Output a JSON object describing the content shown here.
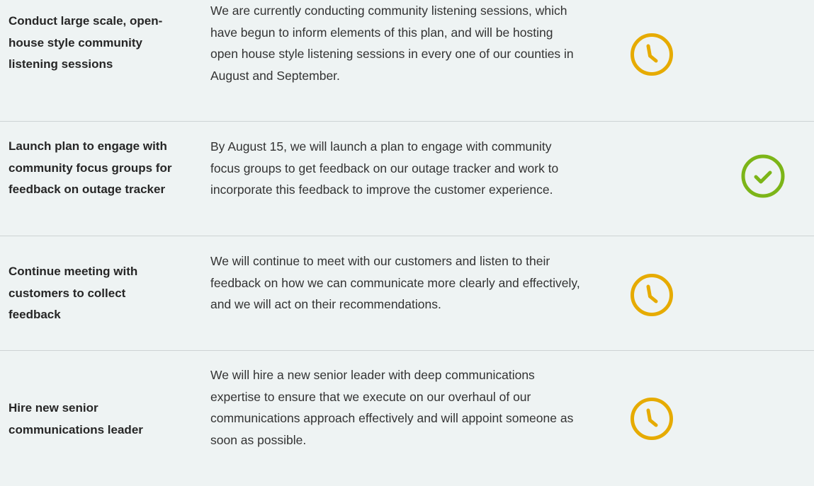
{
  "colors": {
    "background": "#eef3f3",
    "divider": "#cdd3d4",
    "in_progress": "#e6ab00",
    "complete": "#7cb518"
  },
  "rows": [
    {
      "title": "Conduct large scale, open-house style community listening sessions",
      "description": "We are currently conducting community listening sessions, which have begun to inform elements of this plan, and will be hosting open house style listening sessions in every one of our counties in August and September.",
      "status": "in-progress",
      "icon": "clock-icon"
    },
    {
      "title": "Launch plan to engage with community focus groups for feedback on outage tracker",
      "description": "By August 15, we will launch a plan to engage with community focus groups to get feedback on our outage tracker and work to incorporate this feedback to improve the customer experience.",
      "status": "complete",
      "icon": "checkmark-circle-icon"
    },
    {
      "title": "Continue meeting with customers to collect feedback",
      "description": "We will continue to meet with our customers and listen to their feedback on how we can communicate more clearly and effectively, and we will act on their recommendations.",
      "status": "in-progress",
      "icon": "clock-icon"
    },
    {
      "title": "Hire new senior communications leader",
      "description": "We will hire a new senior leader with deep communications expertise to ensure that we execute on our overhaul of our communications approach effectively and will appoint someone as soon as possible.",
      "status": "in-progress",
      "icon": "clock-icon"
    }
  ]
}
